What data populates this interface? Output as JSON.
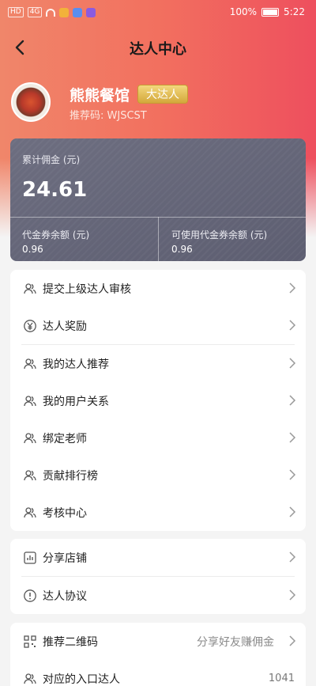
{
  "status_bar": {
    "carrier_chip_1": "HD",
    "carrier_chip_2": "4G",
    "battery": "100%",
    "time": "5:22"
  },
  "nav": {
    "title": "达人中心"
  },
  "profile": {
    "name": "熊熊餐馆",
    "badge": "大达人",
    "referral": "推荐码: WJSCST"
  },
  "earnings": {
    "total_label": "累计佣金 (元)",
    "total_value": "24.61",
    "voucher_label": "代金券余额 (元)",
    "voucher_value": "0.96",
    "usable_label": "可使用代金券余额 (元)",
    "usable_value": "0.96"
  },
  "menu_main": [
    {
      "label": "提交上级达人审核",
      "icon": "users-icon"
    },
    {
      "label": "达人奖励",
      "icon": "yen-icon"
    },
    {
      "label": "我的达人推荐",
      "icon": "users-icon"
    },
    {
      "label": "我的用户关系",
      "icon": "users-icon"
    },
    {
      "label": "绑定老师",
      "icon": "users-icon"
    },
    {
      "label": "贡献排行榜",
      "icon": "users-icon"
    },
    {
      "label": "考核中心",
      "icon": "users-icon"
    }
  ],
  "menu_share": [
    {
      "label": "分享店铺",
      "icon": "chart-icon"
    },
    {
      "label": "达人协议",
      "icon": "info-icon"
    }
  ],
  "menu_qr": [
    {
      "label": "推荐二维码",
      "hint": "分享好友赚佣金",
      "icon": "qr-icon"
    },
    {
      "label": "对应的入口达人",
      "count": "1041",
      "icon": "users-icon"
    }
  ],
  "colors": {
    "hero_start": "#f0866a",
    "hero_end": "#ee4f5e",
    "card_bg": "#62637a",
    "badge_gold": "#d9ae45"
  }
}
